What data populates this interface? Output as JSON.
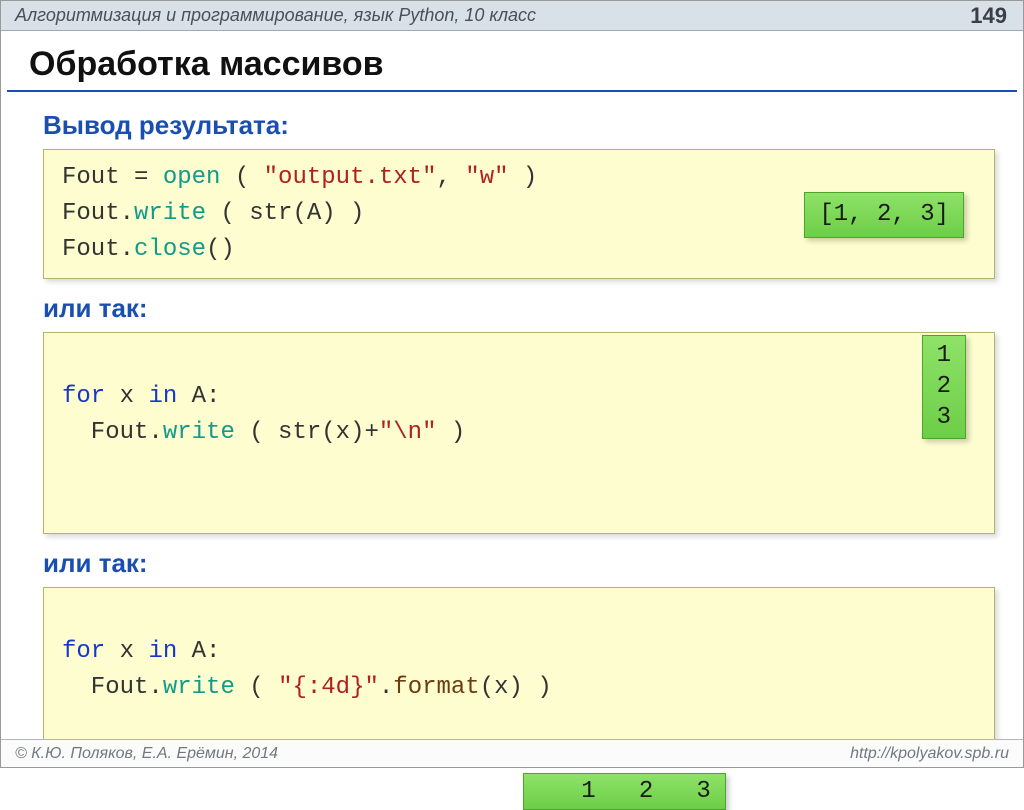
{
  "header": {
    "breadcrumb": "Алгоритмизация и программирование, язык Python, 10 класс",
    "page_number": "149"
  },
  "title": "Обработка массивов",
  "sections": {
    "subhead1": "Вывод результата:",
    "code1": {
      "l1a": "Fout",
      "l1b": " = ",
      "l1c": "open",
      "l1d": " ( ",
      "l1e": "\"output.txt\"",
      "l1f": ", ",
      "l1g": "\"w\"",
      "l1h": " )",
      "l2a": "Fout.",
      "l2b": "write",
      "l2c": " ( str(A) )",
      "l3a": "Fout.",
      "l3b": "close",
      "l3c": "()"
    },
    "out1": "[1, 2, 3]",
    "subhead2": "или так:",
    "code2": {
      "l1a": "for",
      "l1b": " x ",
      "l1c": "in",
      "l1d": " A:",
      "l2a": "  Fout.",
      "l2b": "write",
      "l2c": " ( str(x)+",
      "l2d": "\"\\n\"",
      "l2e": " )"
    },
    "out2": "1\n2\n3",
    "subhead3": "или так:",
    "code3": {
      "l1a": "for",
      "l1b": " x ",
      "l1c": "in",
      "l1d": " A:",
      "l2a": "  Fout.",
      "l2b": "write",
      "l2c": " ( ",
      "l2d": "\"{:4d}\"",
      "l2e": ".",
      "l2f": "format",
      "l2g": "(x) )"
    },
    "out3": "   1   2   3"
  },
  "footer": {
    "left": "© К.Ю. Поляков, Е.А. Ерёмин, 2014",
    "right": "http://kpolyakov.spb.ru"
  }
}
